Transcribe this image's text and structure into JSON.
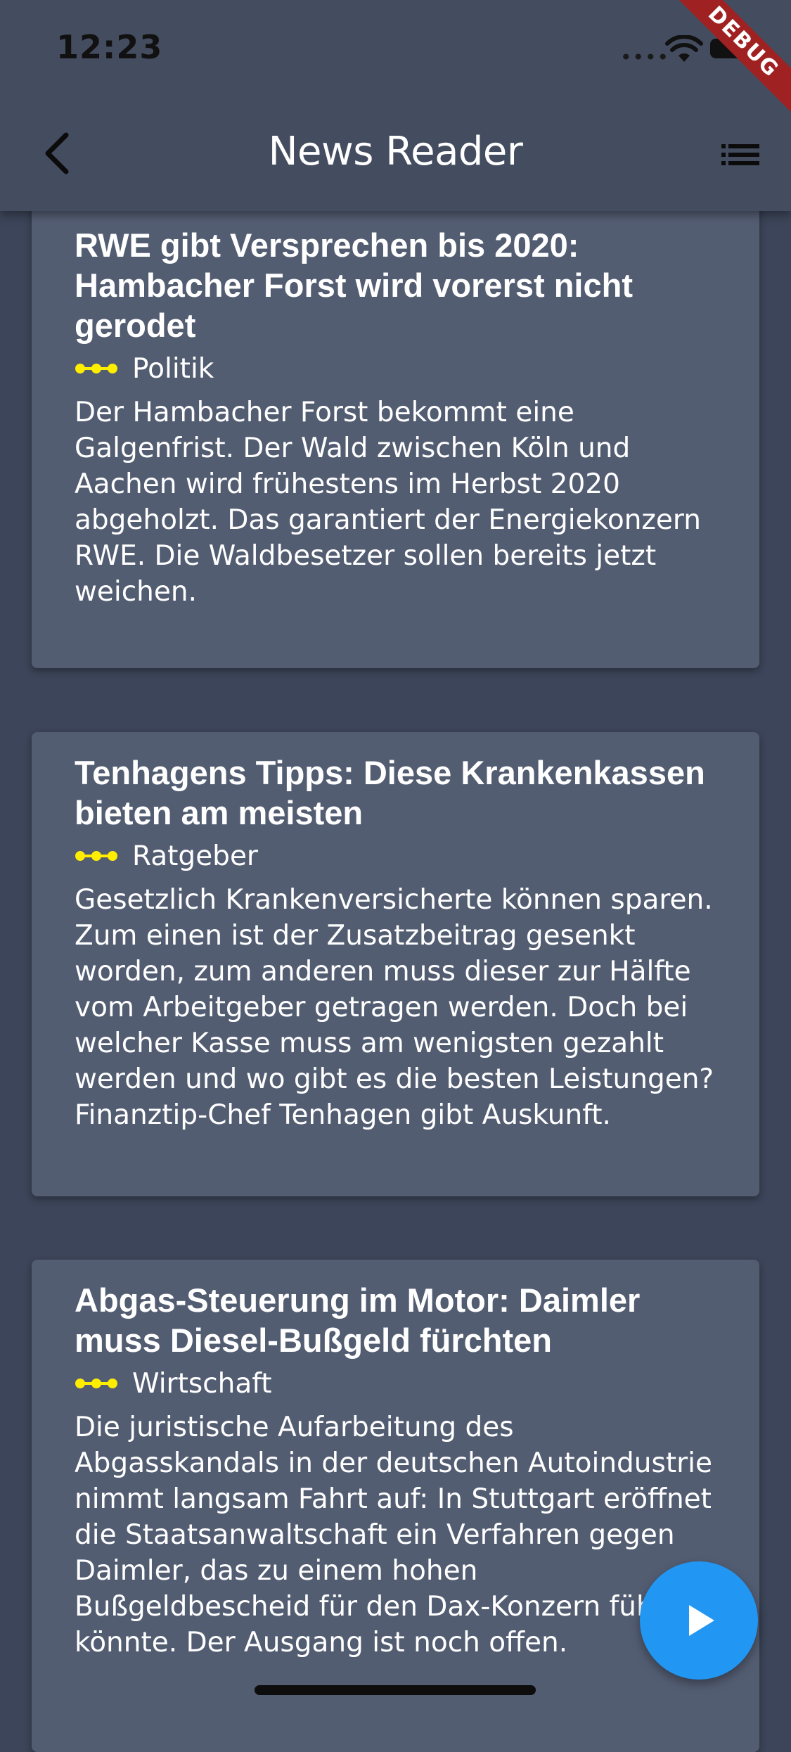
{
  "status_bar": {
    "time": "12:23",
    "signal": "••••",
    "wifi_icon": "wifi-icon",
    "battery_icon": "battery-icon"
  },
  "debug_banner": "DEBUG",
  "app_bar": {
    "title": "News Reader",
    "back_icon": "chevron-left-icon",
    "menu_icon": "list-icon"
  },
  "colors": {
    "app_bar": "#444c5f",
    "background": "#3c4559",
    "card": "#535d72",
    "category_dots": "#ffee00",
    "fab": "#2196f3",
    "debug_banner": "#a02121"
  },
  "articles": [
    {
      "title": "RWE gibt Versprechen bis 2020: Hambacher Forst wird vorerst nicht gerodet",
      "category": "Politik",
      "summary": " Der Hambacher Forst bekommt eine Galgenfrist. Der Wald zwischen Köln und Aachen wird frühestens im Herbst 2020 abgeholzt. Das garantiert der Energiekonzern RWE. Die Waldbesetzer sollen bereits jetzt weichen."
    },
    {
      "title": "Tenhagens Tipps: Diese Krankenkassen bieten am meisten",
      "category": "Ratgeber",
      "summary": " Gesetzlich Krankenversicherte können sparen. Zum einen ist der Zusatzbeitrag gesenkt worden, zum anderen muss dieser zur Hälfte vom Arbeitgeber getragen werden. Doch bei welcher Kasse muss am wenigsten gezahlt werden und wo gibt es die besten Leistungen? Finanztip-Chef Tenhagen gibt Auskunft."
    },
    {
      "title": "Abgas-Steuerung im Motor: Daimler muss Diesel-Bußgeld fürchten",
      "category": "Wirtschaft",
      "summary": " Die juristische Aufarbeitung des Abgasskandals in der deutschen Autoindustrie nimmt langsam Fahrt auf: In Stuttgart eröffnet die Staatsanwaltschaft ein Verfahren gegen Daimler, das zu einem hohen Bußgeldbescheid für den Dax-Konzern führen könnte. Der Ausgang ist noch offen."
    }
  ],
  "fab": {
    "icon": "play-icon"
  }
}
